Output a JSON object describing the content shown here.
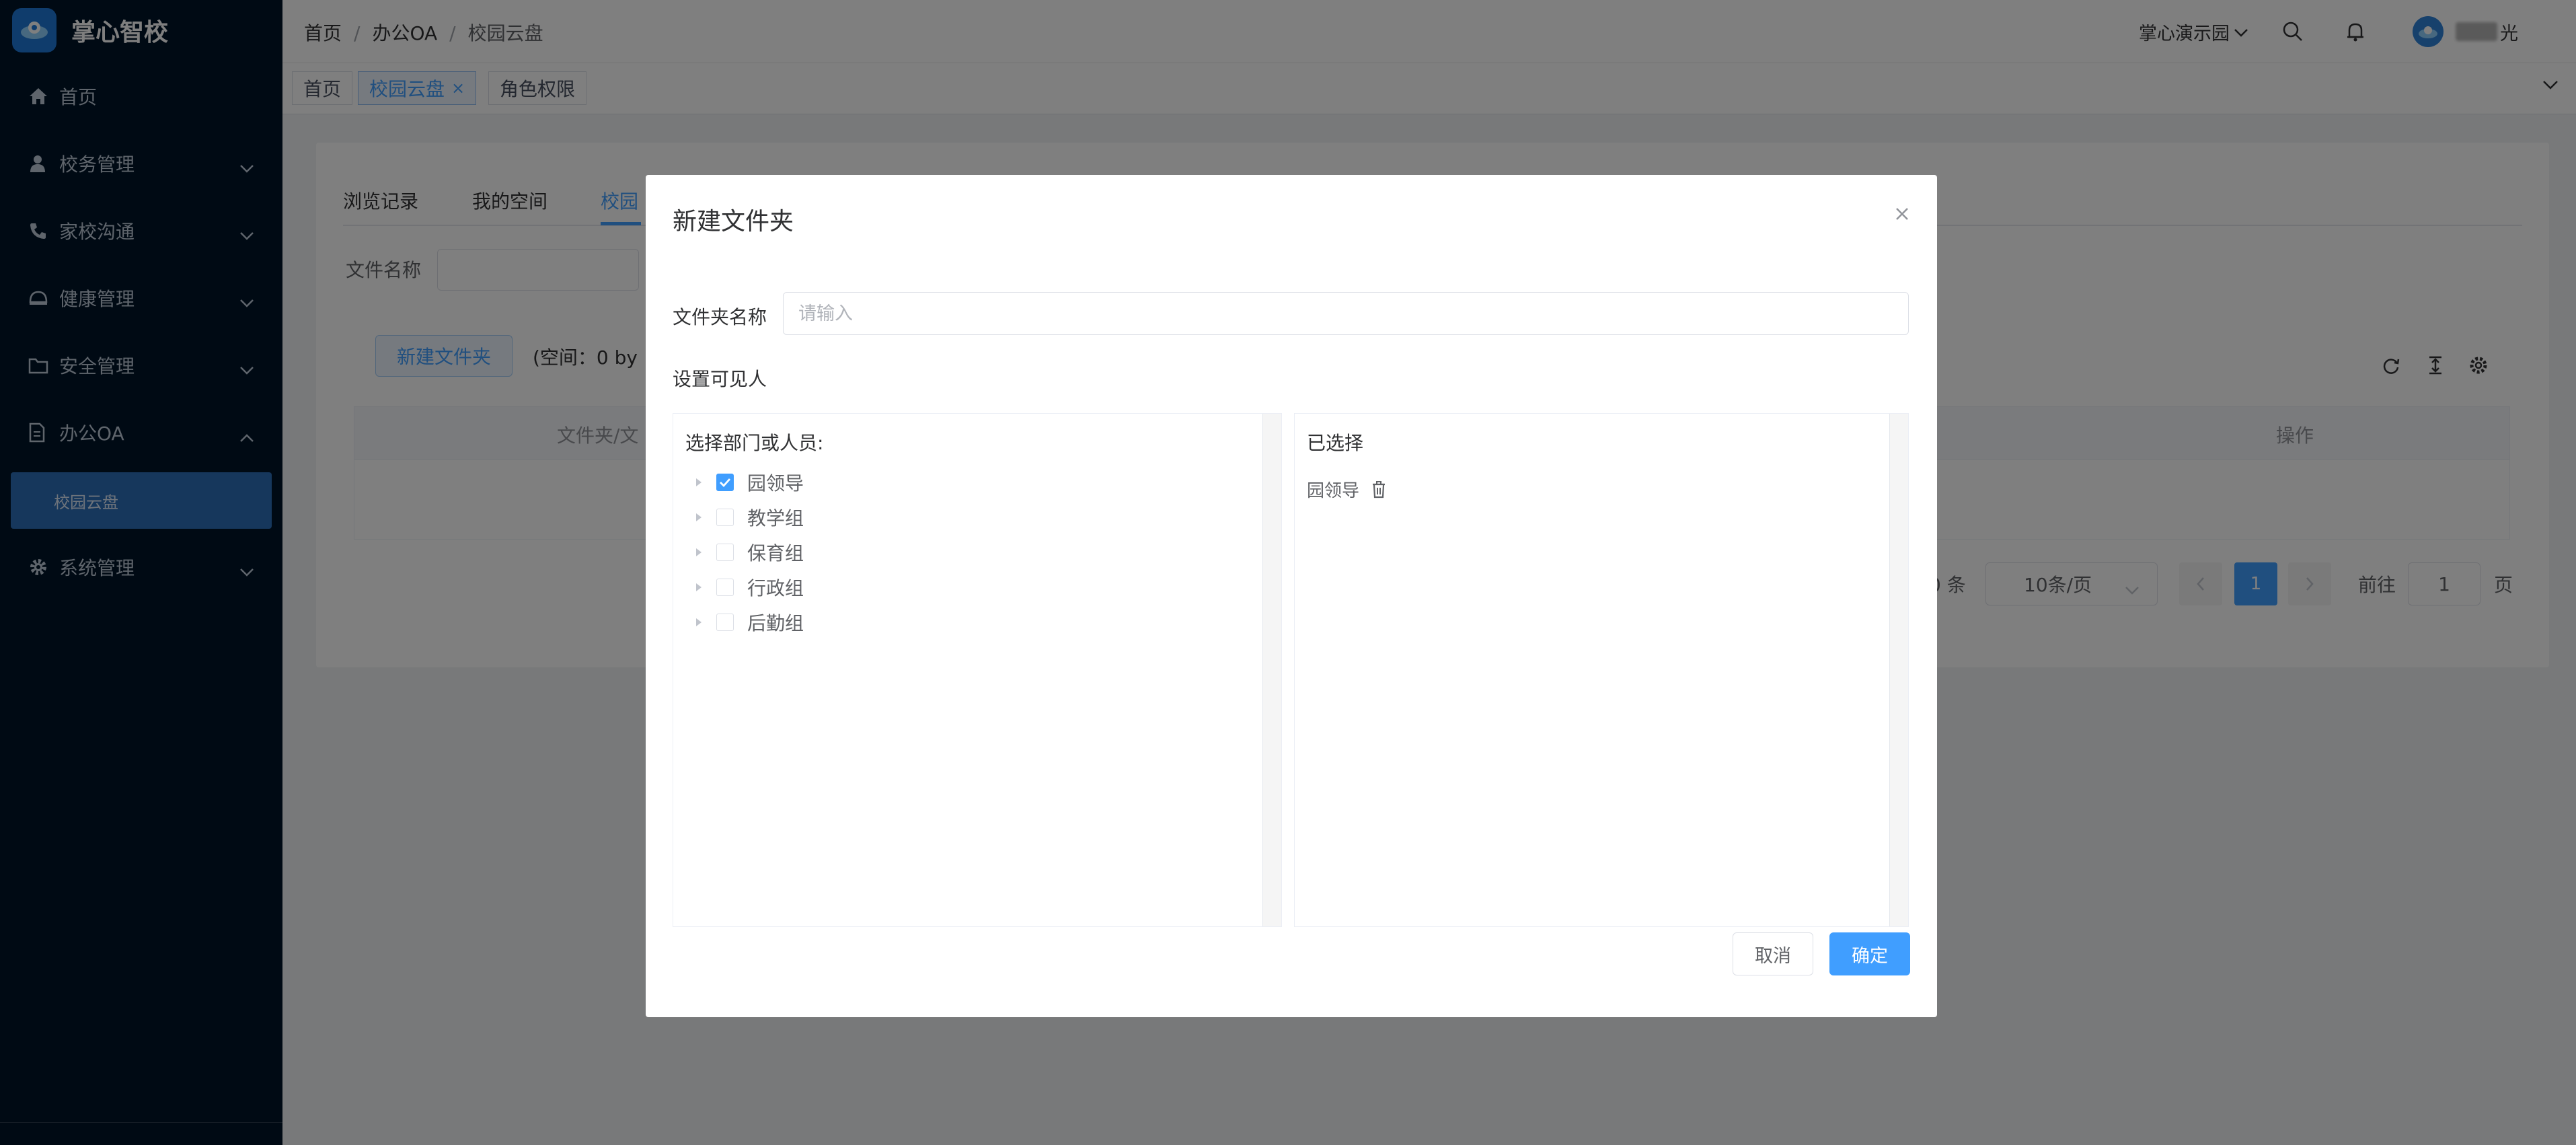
{
  "app": {
    "title": "掌心智校"
  },
  "sidebar": {
    "items": [
      {
        "label": "首页",
        "icon": "home-icon"
      },
      {
        "label": "校务管理",
        "icon": "user-icon"
      },
      {
        "label": "家校沟通",
        "icon": "phone-icon"
      },
      {
        "label": "健康管理",
        "icon": "helmet-icon"
      },
      {
        "label": "安全管理",
        "icon": "folder-icon"
      },
      {
        "label": "办公OA",
        "icon": "document-icon",
        "expanded": true
      },
      {
        "label": "系统管理",
        "icon": "gear-icon"
      }
    ],
    "active_sub": "校园云盘"
  },
  "header": {
    "breadcrumb": [
      "首页",
      "办公OA",
      "校园云盘"
    ],
    "school": "掌心演示园",
    "user_suffix": "光"
  },
  "tags": [
    {
      "label": "首页"
    },
    {
      "label": "校园云盘",
      "active": true,
      "close": "×"
    },
    {
      "label": "角色权限"
    }
  ],
  "main": {
    "tabs": [
      "浏览记录",
      "我的空间",
      "校园"
    ],
    "filter_label": "文件名称",
    "new_folder_button": "新建文件夹",
    "space_text": "(空间：0 by",
    "table_headers": [
      "文件夹/文",
      "操作"
    ],
    "pagination": {
      "total_suffix": "0 条",
      "page_size": "10条/页",
      "current_page": "1",
      "goto_label": "前往",
      "goto_value": "1",
      "page_unit": "页"
    }
  },
  "dialog": {
    "title": "新建文件夹",
    "folder_name_label": "文件夹名称",
    "folder_name_placeholder": "请输入",
    "visibility_label": "设置可见人",
    "left_panel_title": "选择部门或人员:",
    "tree": [
      {
        "label": "园领导",
        "checked": true
      },
      {
        "label": "教学组",
        "checked": false
      },
      {
        "label": "保育组",
        "checked": false
      },
      {
        "label": "行政组",
        "checked": false
      },
      {
        "label": "后勤组",
        "checked": false
      }
    ],
    "right_panel_title": "已选择",
    "selected": [
      "园领导"
    ],
    "cancel": "取消",
    "confirm": "确定"
  },
  "colors": {
    "primary": "#409eff",
    "sidebar_bg": "#001529",
    "submenu_active": "#2d6fb8"
  }
}
